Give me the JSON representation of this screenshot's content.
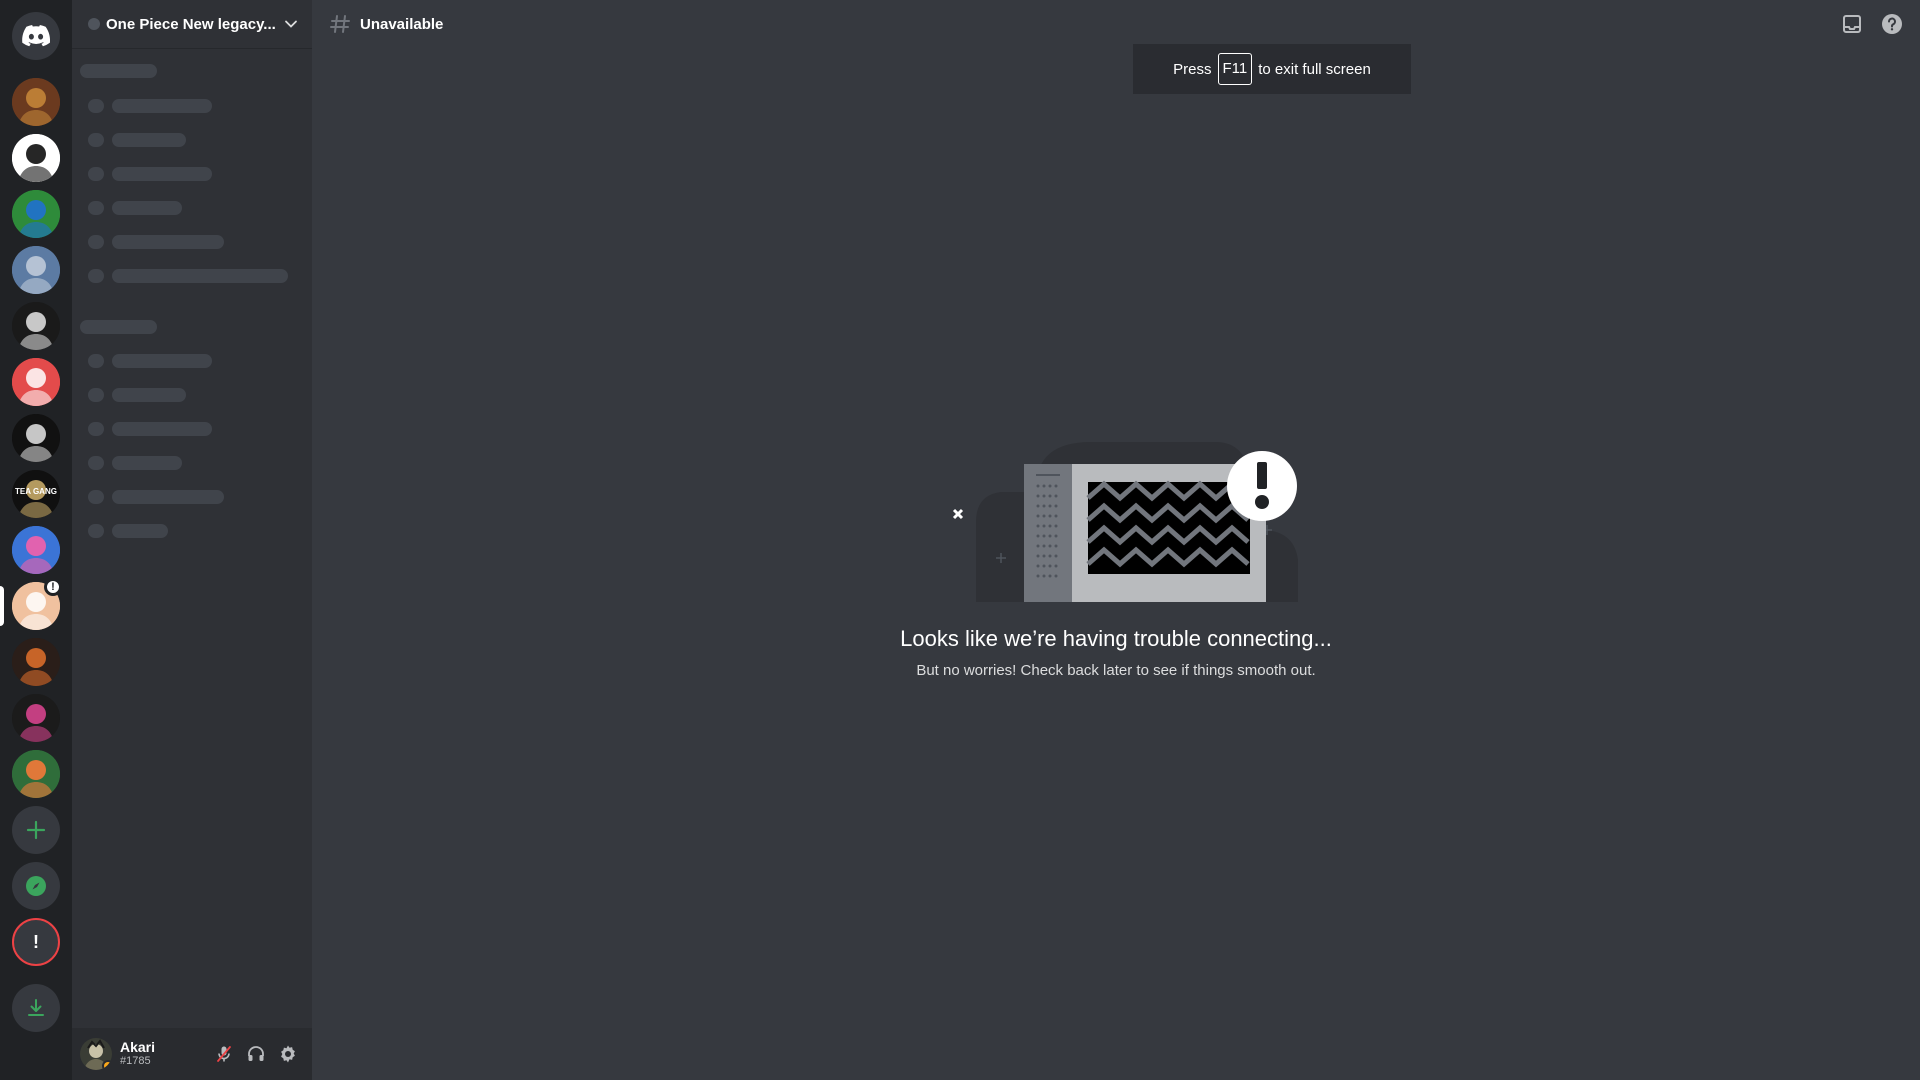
{
  "server_rail": {
    "home_icon": "discord-logo-icon",
    "servers": [
      {
        "name": "server-1",
        "colors": [
          "#6b3a1f",
          "#c98a3a"
        ]
      },
      {
        "name": "server-2",
        "colors": [
          "#ffffff",
          "#000000"
        ]
      },
      {
        "name": "server-3",
        "colors": [
          "#2e8b3a",
          "#1e6fd9"
        ]
      },
      {
        "name": "server-4",
        "colors": [
          "#5c7ba3",
          "#c4cfdd"
        ]
      },
      {
        "name": "server-5",
        "colors": [
          "#1a1a1a",
          "#e8e8e8"
        ]
      },
      {
        "name": "server-6",
        "colors": [
          "#e34b4b",
          "#ffffff"
        ]
      },
      {
        "name": "server-7",
        "colors": [
          "#111111",
          "#e6e6e6"
        ]
      },
      {
        "name": "server-8",
        "colors": [
          "#101010",
          "#d1b36d"
        ],
        "label": "TEA GANG"
      },
      {
        "name": "server-9",
        "colors": [
          "#3b74d6",
          "#ff5fa8"
        ]
      },
      {
        "name": "server-10",
        "colors": [
          "#f0c19f",
          "#ffffff"
        ],
        "active": true,
        "badge": "!"
      },
      {
        "name": "server-11",
        "colors": [
          "#2a1e19",
          "#e3712b"
        ]
      },
      {
        "name": "server-12",
        "colors": [
          "#1b1b1b",
          "#e04593"
        ]
      },
      {
        "name": "server-13",
        "colors": [
          "#2f6d3a",
          "#ff7a3a"
        ]
      }
    ],
    "add_server_icon": "plus-icon",
    "explore_icon": "compass-icon",
    "alert_label": "!",
    "download_icon": "download-icon"
  },
  "sidebar": {
    "guild_name": "One Piece New legacy...",
    "user": {
      "name": "Akari",
      "tag": "#1785",
      "status_color": "#faa81a"
    }
  },
  "topbar": {
    "channel_name": "Unavailable"
  },
  "fullscreen_toast": {
    "prefix": "Press",
    "key": "F11",
    "suffix": "to exit full screen"
  },
  "error": {
    "title": "Looks like we’re having trouble connecting...",
    "subtitle": "But no worries! Check back later to see if things smooth out."
  },
  "colors": {
    "rail_bg": "#202225",
    "sidebar_bg": "#2f3136",
    "main_bg": "#36393f",
    "user_panel_bg": "#292b2f",
    "green": "#3ba55d",
    "red": "#ed4245"
  }
}
